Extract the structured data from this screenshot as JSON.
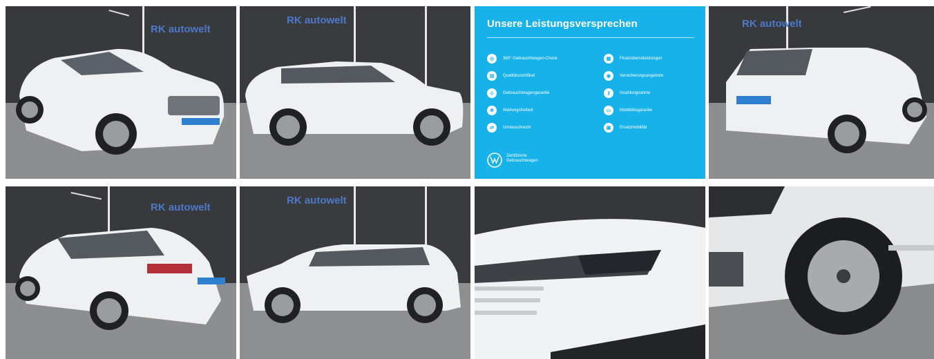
{
  "gallery": {
    "images": [
      {
        "label": "VW Touareg front three-quarter view, showroom"
      },
      {
        "label": "VW Touareg side profile right"
      },
      {
        "label": "Leistungsversprechen promo"
      },
      {
        "label": "VW Touareg rear three-quarter right"
      },
      {
        "label": "VW Touareg rear three-quarter left"
      },
      {
        "label": "VW Touareg side profile left"
      },
      {
        "label": "VW Touareg headlight close-up"
      },
      {
        "label": "VW Touareg front wheel close-up"
      }
    ],
    "watermark": "RK autowelt"
  },
  "promo": {
    "title": "Unsere Leistungsversprechen",
    "left_items": [
      "360° Gebrauchtwagen-Check",
      "Qualitätszertifikat",
      "Gebrauchtwagengarantie",
      "Wartungsfreiheit",
      "Umtauschrecht"
    ],
    "right_items": [
      "Finanzdienstleistungen",
      "Versicherungsangebote",
      "Inzahlungnahme",
      "Mobilitätsgarantie",
      "Ersatzmobilität"
    ],
    "footer_line1": "Zertifizierte",
    "footer_line2": "Gebrauchtwagen"
  },
  "colors": {
    "promo_bg": "#17b2ea",
    "car_white": "#f2f3f4",
    "showroom_wall": "#3a3b3f",
    "floor": "#8e8f91",
    "badge_blue": "#2f7fd0"
  }
}
